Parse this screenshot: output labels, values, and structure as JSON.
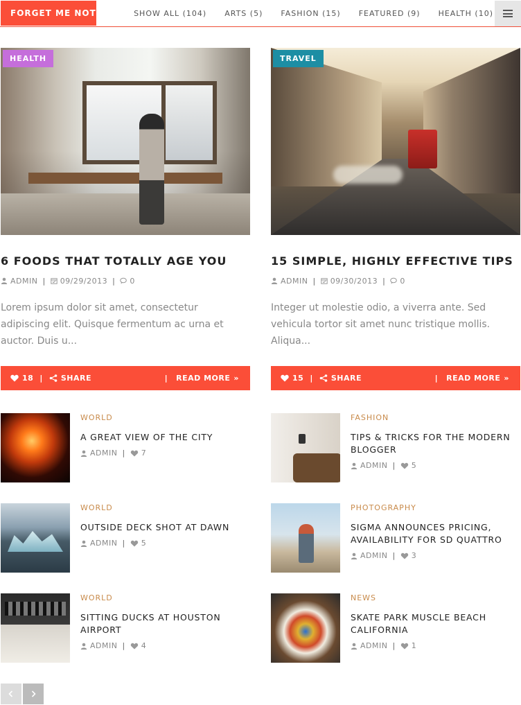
{
  "header": {
    "brand": "FORGET ME NOT",
    "nav": [
      "SHOW ALL (104)",
      "ARTS (5)",
      "FASHION (15)",
      "FEATURED (9)",
      "HEALTH (10)"
    ],
    "menu_icon": "hamburger-icon"
  },
  "colors": {
    "accent": "#fb4e38",
    "health_tag": "#c56edb",
    "travel_tag": "#1d8ea4",
    "category_text": "#c88a4a"
  },
  "featured": [
    {
      "tag": "HEALTH",
      "title": "6 FOODS THAT TOTALLY AGE YOU",
      "author": "ADMIN",
      "date": "09/29/2013",
      "comments": "0",
      "excerpt": "Lorem ipsum dolor sit amet, consectetur adipiscing elit. Quisque fermentum ac urna et auctor. Duis u...",
      "likes": "18",
      "share": "SHARE",
      "read_more": "READ MORE"
    },
    {
      "tag": "TRAVEL",
      "title": "15 SIMPLE, HIGHLY EFFECTIVE TIPS",
      "author": "ADMIN",
      "date": "09/30/2013",
      "comments": "0",
      "excerpt": "Integer ut molestie odio, a viverra ante. Sed vehicula tortor sit amet nunc tristique mollis. Aliqua...",
      "likes": "15",
      "share": "SHARE",
      "read_more": "READ MORE"
    }
  ],
  "posts": [
    {
      "category": "WORLD",
      "title": "A GREAT VIEW OF THE CITY",
      "author": "ADMIN",
      "likes": "7"
    },
    {
      "category": "FASHION",
      "title": "TIPS & TRICKS FOR THE MODERN BLOGGER",
      "author": "ADMIN",
      "likes": "5"
    },
    {
      "category": "WORLD",
      "title": "OUTSIDE DECK SHOT AT DAWN",
      "author": "ADMIN",
      "likes": "5"
    },
    {
      "category": "PHOTOGRAPHY",
      "title": "SIGMA ANNOUNCES PRICING, AVAILABILITY FOR SD QUATTRO",
      "author": "ADMIN",
      "likes": "3"
    },
    {
      "category": "WORLD",
      "title": "SITTING DUCKS AT HOUSTON AIRPORT",
      "author": "ADMIN",
      "likes": "4"
    },
    {
      "category": "NEWS",
      "title": "SKATE PARK MUSCLE BEACH CALIFORNIA",
      "author": "ADMIN",
      "likes": "1"
    }
  ],
  "pager": {
    "prev_icon": "chevron-left-icon",
    "next_icon": "chevron-right-icon"
  }
}
